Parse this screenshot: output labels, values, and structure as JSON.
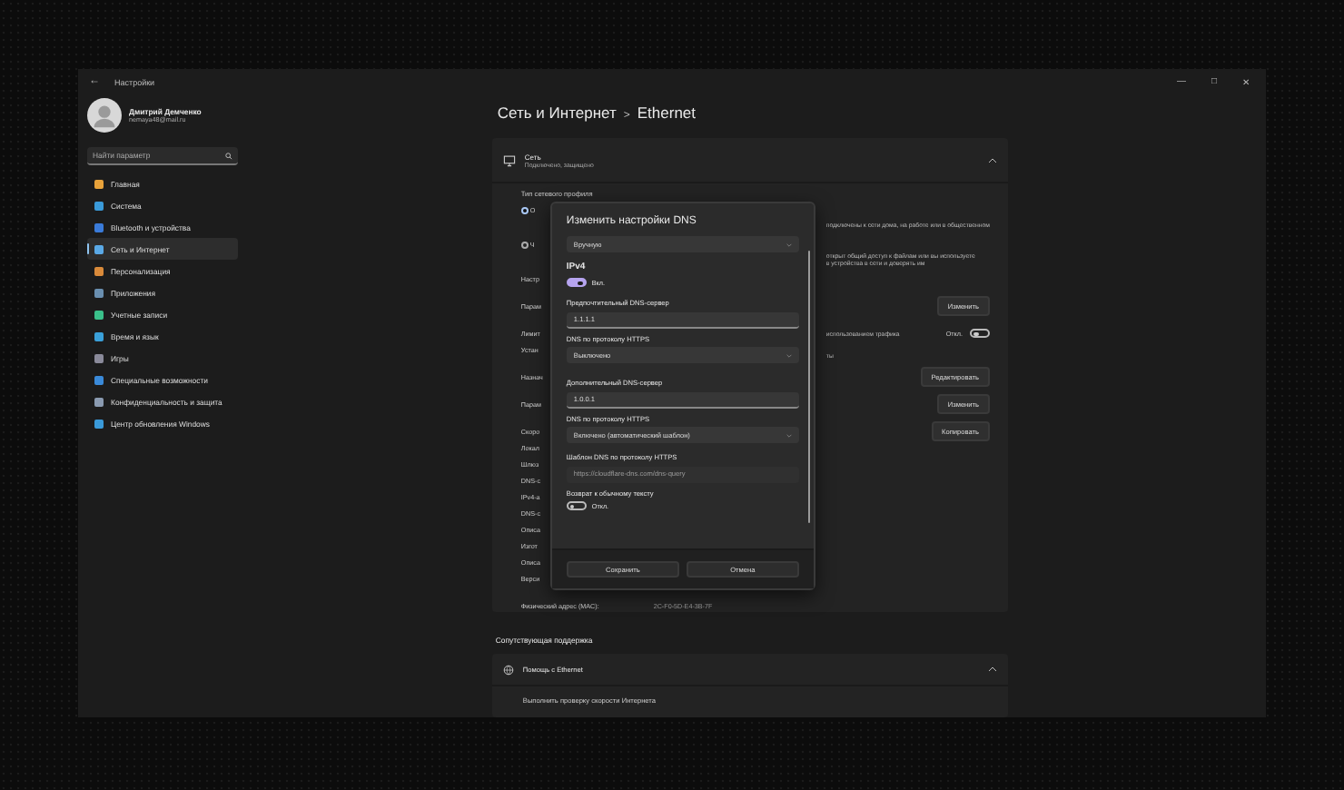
{
  "window": {
    "back": "←",
    "title": "Настройки",
    "controls": [
      "—",
      "□",
      "✕"
    ]
  },
  "user": {
    "name": "Дмитрий Демченко",
    "email": "nemaya48@mail.ru"
  },
  "search": {
    "placeholder": "Найти параметр"
  },
  "sidebar": {
    "items": [
      {
        "label": "Главная",
        "selected": false
      },
      {
        "label": "Система",
        "selected": false
      },
      {
        "label": "Bluetooth и устройства",
        "selected": false
      },
      {
        "label": "Сеть и Интернет",
        "selected": true
      },
      {
        "label": "Персонализация",
        "selected": false
      },
      {
        "label": "Приложения",
        "selected": false
      },
      {
        "label": "Учетные записи",
        "selected": false
      },
      {
        "label": "Время и язык",
        "selected": false
      },
      {
        "label": "Игры",
        "selected": false
      },
      {
        "label": "Специальные возможности",
        "selected": false
      },
      {
        "label": "Конфиденциальность и защита",
        "selected": false
      },
      {
        "label": "Центр обновления Windows",
        "selected": false
      }
    ]
  },
  "breadcrumb": {
    "parent": "Сеть и Интернет",
    "separator": ">",
    "current": "Ethernet"
  },
  "network_card": {
    "title": "Сеть",
    "subtitle": "Подключено, защищено",
    "section_label": "Тип сетевого профиля",
    "rows": [
      {
        "kind": "radio",
        "left": "О",
        "selected": true,
        "right": [
          "подключены к сети дома, на работе или в общественном"
        ]
      },
      {
        "kind": "radio",
        "left": "Ч",
        "selected": false,
        "right": [
          "открыт общий доступ к файлам или вы используете",
          "в устройства в сети и доверять им"
        ]
      },
      {
        "kind": "text",
        "left": "Настр"
      },
      {
        "kind": "button",
        "left": "Парам",
        "button": "Изменить"
      },
      {
        "kind": "toggle",
        "left": "Лимит",
        "right": [
          "использованием трафика"
        ],
        "toggle_label": "Откл.",
        "on": false
      },
      {
        "kind": "text",
        "left": "Устан",
        "right": [
          "ты"
        ]
      },
      {
        "kind": "button",
        "left": "Назнач",
        "button": "Редактировать"
      },
      {
        "kind": "button",
        "left": "Парам",
        "button": "Изменить"
      },
      {
        "kind": "button",
        "left": "Скоро",
        "button": "Копировать"
      },
      {
        "kind": "text",
        "left": "Локал"
      },
      {
        "kind": "text",
        "left": "Шлюз"
      },
      {
        "kind": "text",
        "left": "DNS-с"
      },
      {
        "kind": "text",
        "left": "IPv4-а"
      },
      {
        "kind": "text",
        "left": "DNS-с"
      },
      {
        "kind": "text",
        "left": "Описа"
      },
      {
        "kind": "text",
        "left": "Изгот"
      },
      {
        "kind": "text",
        "left": "Описа"
      },
      {
        "kind": "text",
        "left": "Верси"
      }
    ],
    "mac": {
      "label": "Физический адрес (MAC):",
      "value": "2C-F0-5D-E4-3B-7F"
    }
  },
  "support": {
    "heading": "Сопутствующая поддержка",
    "item": "Помощь с Ethernet",
    "expanded": true,
    "link": "Выполнить проверку скорости Интернета"
  },
  "dialog": {
    "title": "Изменить настройки DNS",
    "mode": "Вручную",
    "section": "IPv4",
    "ipv4_on": true,
    "ipv4_label": "Вкл.",
    "fields": [
      {
        "kind": "input",
        "label": "Предпочтительный DNS-сервер",
        "value": "1.1.1.1"
      },
      {
        "kind": "select",
        "label": "DNS по протоколу HTTPS",
        "value": "Выключено"
      },
      {
        "kind": "input",
        "label": "Дополнительный DNS-сервер",
        "value": "1.0.0.1"
      },
      {
        "kind": "select",
        "label": "DNS по протоколу HTTPS",
        "value": "Включено (автоматический шаблон)"
      },
      {
        "kind": "disabled_input",
        "label": "Шаблон DNS по протоколу HTTPS",
        "placeholder": "https://cloudflare-dns.com/dns-query"
      },
      {
        "kind": "toggle",
        "label": "Возврат к обычному тексту",
        "on": false,
        "value": "Откл."
      }
    ],
    "buttons": [
      {
        "label": "Сохранить"
      },
      {
        "label": "Отмена"
      }
    ]
  }
}
